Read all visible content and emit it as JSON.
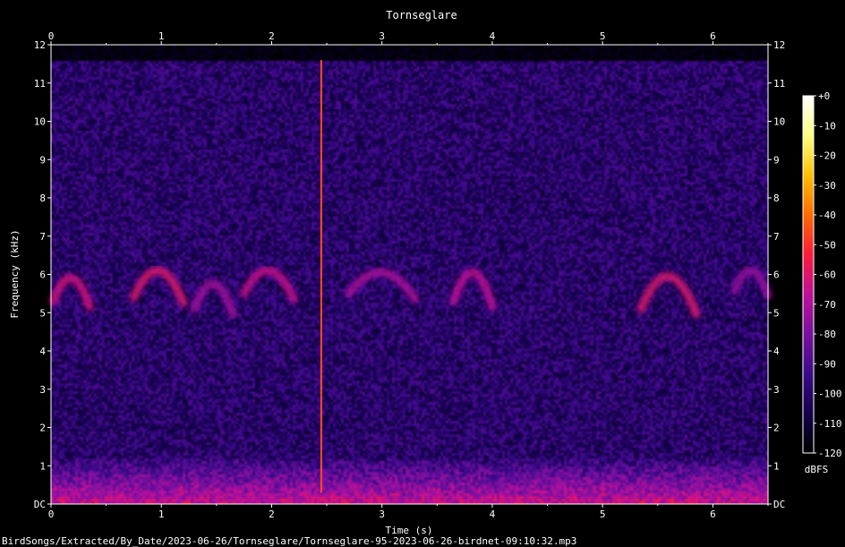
{
  "chart_data": {
    "type": "heatmap",
    "title": "Tornseglare",
    "xlabel": "Time (s)",
    "ylabel": "Frequency (kHz)",
    "xlim": [
      0,
      6.5
    ],
    "ylim": [
      0,
      12
    ],
    "x_ticks": [
      "0",
      "1",
      "2",
      "3",
      "4",
      "5",
      "6"
    ],
    "y_ticks": [
      "DC",
      "1",
      "2",
      "3",
      "4",
      "5",
      "6",
      "7",
      "8",
      "9",
      "10",
      "11",
      "12"
    ],
    "colorbar": {
      "unit": "dBFS",
      "range": [
        -120,
        0
      ],
      "ticks": [
        "+0",
        "-10",
        "-20",
        "-30",
        "-40",
        "-50",
        "-60",
        "-70",
        "-80",
        "-90",
        "-100",
        "-110",
        "-120"
      ],
      "colors": [
        "#000000",
        "#14004a",
        "#3b0a8a",
        "#7a10a0",
        "#c0109a",
        "#ff1a3a",
        "#ff6a00",
        "#ffc000",
        "#ffff80",
        "#ffffff"
      ]
    },
    "background_level_dbfs": -100,
    "low_band_level_dbfs": -68,
    "calls": [
      {
        "t_start": 0.02,
        "t_end": 0.35,
        "f_low": 5.2,
        "f_high": 6.3,
        "peak_dbfs": -62
      },
      {
        "t_start": 0.75,
        "t_end": 1.2,
        "f_low": 5.3,
        "f_high": 6.6,
        "peak_dbfs": -60
      },
      {
        "t_start": 1.3,
        "t_end": 1.65,
        "f_low": 5.0,
        "f_high": 6.2,
        "peak_dbfs": -72
      },
      {
        "t_start": 1.75,
        "t_end": 2.2,
        "f_low": 5.4,
        "f_high": 6.5,
        "peak_dbfs": -64
      },
      {
        "t_start": 2.7,
        "t_end": 3.3,
        "f_low": 5.4,
        "f_high": 6.4,
        "peak_dbfs": -70
      },
      {
        "t_start": 3.65,
        "t_end": 4.0,
        "f_low": 5.2,
        "f_high": 6.6,
        "peak_dbfs": -66
      },
      {
        "t_start": 5.35,
        "t_end": 5.85,
        "f_low": 5.0,
        "f_high": 6.6,
        "peak_dbfs": -60
      },
      {
        "t_start": 6.2,
        "t_end": 6.5,
        "f_low": 5.5,
        "f_high": 6.4,
        "peak_dbfs": -74
      }
    ],
    "transient": {
      "t": 2.45,
      "f_low": 0.3,
      "f_high": 11.6,
      "peak_dbfs": -45
    }
  },
  "file_path": "BirdSongs/Extracted/By_Date/2023-06-26/Tornseglare/Tornseglare-95-2023-06-26-birdnet-09:10:32.mp3"
}
